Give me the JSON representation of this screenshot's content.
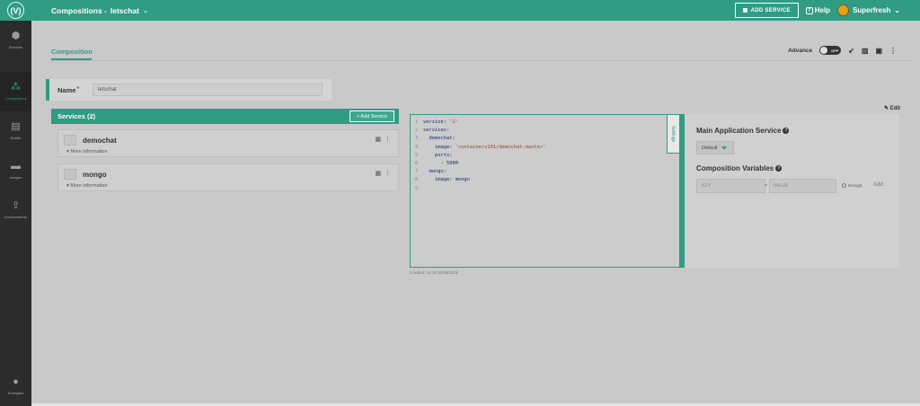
{
  "header": {
    "logo_text": "(V)",
    "breadcrumb_section": "Compositions -",
    "breadcrumb_item": "letschat",
    "add_service_label": "ADD SERVICE",
    "help_label": "Help",
    "user_name": "Superfresh"
  },
  "sidebar": {
    "items": [
      {
        "label": "Services",
        "icon": "cube-icon"
      },
      {
        "label": "Compositions",
        "icon": "compositions-icon"
      },
      {
        "label": "Builds",
        "icon": "document-icon"
      },
      {
        "label": "Images",
        "icon": "disk-icon"
      },
      {
        "label": "Environments",
        "icon": "upload-icon"
      }
    ],
    "bottom_item": {
      "label": "Examples",
      "icon": "bulb-icon"
    }
  },
  "tabs": {
    "composition_label": "Composition"
  },
  "toolbar": {
    "advance_label": "Advance",
    "toggle_state": "OFF"
  },
  "name_field": {
    "label": "Name",
    "required_mark": "*",
    "value": "letschat"
  },
  "services": {
    "title": "Services (2)",
    "add_label": "+ Add Service",
    "items": [
      {
        "name": "demochat",
        "more": "▾ More information"
      },
      {
        "name": "mongo",
        "more": "▾ More information"
      }
    ]
  },
  "editor": {
    "lines": [
      {
        "n": "1",
        "key": "version: ",
        "str": "'2'"
      },
      {
        "n": "2",
        "key": "services:",
        "str": ""
      },
      {
        "n": "3",
        "key": "  demochat:",
        "str": ""
      },
      {
        "n": "4",
        "key": "    image: ",
        "str": "'containers101/demochat:master'"
      },
      {
        "n": "5",
        "key": "    ports:",
        "str": ""
      },
      {
        "n": "6",
        "key": "      - 5000",
        "str": ""
      },
      {
        "n": "7",
        "key": "  mongo:",
        "str": ""
      },
      {
        "n": "8",
        "key": "    image: mongo",
        "str": ""
      },
      {
        "n": "9",
        "key": "",
        "str": ""
      }
    ],
    "settings_tab": "Settings",
    "created": "Created: 15:19 20/09/2016"
  },
  "right_panel": {
    "edit_label": "Edit",
    "main_service_title": "Main Application Service",
    "default_option": "Default",
    "variables_title": "Composition Variables",
    "key_placeholder": "KEY",
    "value_placeholder": "VALUE",
    "equals": "=",
    "encrypt_label": "Encrypt",
    "add_label": "Add"
  },
  "colors": {
    "accent": "#2f9c83",
    "sidebar": "#2c2c2c",
    "overlay_bg": "#c9c9c9"
  }
}
